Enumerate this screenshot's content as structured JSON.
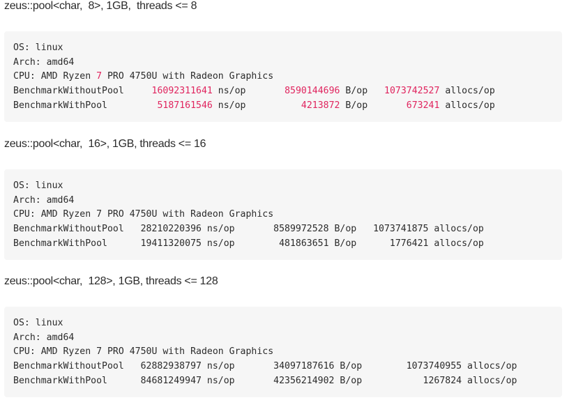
{
  "sections": [
    {
      "heading": "zeus::pool<char,  8>, 1GB,  threads <= 8",
      "lines": [
        {
          "segments": [
            {
              "text": "OS: linux",
              "style": "plain"
            }
          ]
        },
        {
          "segments": [
            {
              "text": "Arch: amd64",
              "style": "plain"
            }
          ]
        },
        {
          "segments": [
            {
              "text": "CPU: AMD Ryzen ",
              "style": "plain"
            },
            {
              "text": "7",
              "style": "num"
            },
            {
              "text": " PRO 4750U with Radeon Graphics",
              "style": "plain"
            }
          ]
        },
        {
          "segments": [
            {
              "text": "BenchmarkWithoutPool     ",
              "style": "plain"
            },
            {
              "text": "16092311641",
              "style": "num"
            },
            {
              "text": " ns/op       ",
              "style": "plain"
            },
            {
              "text": "8590144696",
              "style": "num"
            },
            {
              "text": " B/op   ",
              "style": "plain"
            },
            {
              "text": "1073742527",
              "style": "num"
            },
            {
              "text": " allocs/op",
              "style": "plain"
            }
          ]
        },
        {
          "segments": [
            {
              "text": "BenchmarkWithPool         ",
              "style": "plain"
            },
            {
              "text": "5187161546",
              "style": "num"
            },
            {
              "text": " ns/op          ",
              "style": "plain"
            },
            {
              "text": "4213872",
              "style": "num"
            },
            {
              "text": " B/op       ",
              "style": "plain"
            },
            {
              "text": "673241",
              "style": "num"
            },
            {
              "text": " allocs/op",
              "style": "plain"
            }
          ]
        }
      ]
    },
    {
      "heading": "zeus::pool<char,  16>, 1GB, threads <= 16",
      "lines": [
        {
          "segments": [
            {
              "text": "OS: linux",
              "style": "plain"
            }
          ]
        },
        {
          "segments": [
            {
              "text": "Arch: amd64",
              "style": "plain"
            }
          ]
        },
        {
          "segments": [
            {
              "text": "CPU: AMD Ryzen 7 PRO 4750U with Radeon Graphics",
              "style": "plain"
            }
          ]
        },
        {
          "segments": [
            {
              "text": "BenchmarkWithoutPool   28210220396 ns/op       8589972528 B/op   1073741875 allocs/op",
              "style": "plain"
            }
          ]
        },
        {
          "segments": [
            {
              "text": "BenchmarkWithPool      19411320075 ns/op        481863651 B/op      1776421 allocs/op",
              "style": "plain"
            }
          ]
        }
      ]
    },
    {
      "heading": "zeus::pool<char,  128>, 1GB, threads <= 128",
      "lines": [
        {
          "segments": [
            {
              "text": "OS: linux",
              "style": "plain"
            }
          ]
        },
        {
          "segments": [
            {
              "text": "Arch: amd64",
              "style": "plain"
            }
          ]
        },
        {
          "segments": [
            {
              "text": "CPU: AMD Ryzen 7 PRO 4750U with Radeon Graphics",
              "style": "plain"
            }
          ]
        },
        {
          "segments": [
            {
              "text": "BenchmarkWithoutPool   62882938797 ns/op       34097187616 B/op        1073740955 allocs/op",
              "style": "plain"
            }
          ]
        },
        {
          "segments": [
            {
              "text": "BenchmarkWithPool      84681249947 ns/op       42356214902 B/op           1267824 allocs/op",
              "style": "plain"
            }
          ]
        }
      ]
    }
  ],
  "colors": {
    "number_highlight": "#e0245e",
    "code_background": "#f6f6f6",
    "text": "#2b2b2b"
  }
}
